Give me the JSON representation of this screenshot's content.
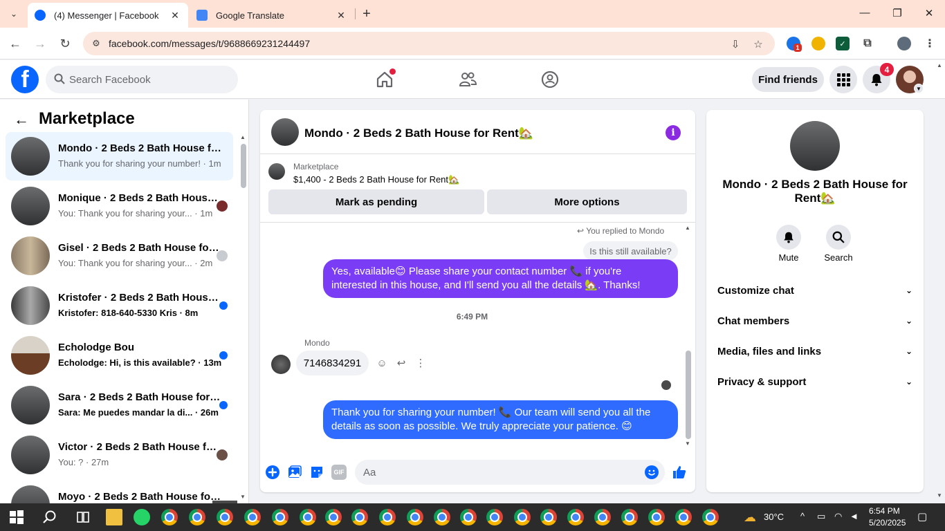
{
  "browser": {
    "tabs": [
      {
        "title": "(4) Messenger | Facebook",
        "active": true
      },
      {
        "title": "Google Translate",
        "active": false
      }
    ],
    "url": "facebook.com/messages/t/9688669231244497",
    "extension_badge": "1"
  },
  "fb": {
    "search_placeholder": "Search Facebook",
    "find_friends": "Find friends",
    "notifications_count": "4"
  },
  "left": {
    "title": "Marketplace",
    "conversations": [
      {
        "name": "Mondo · 2 Beds 2 Bath House for Rent",
        "preview": "Thank you for sharing your number! · 1m",
        "selected": true,
        "unread": false
      },
      {
        "name": "Monique · 2 Beds 2 Bath House for Rent",
        "preview": "You: Thank you for sharing your... · 1m",
        "selected": false,
        "unread": false
      },
      {
        "name": "Gisel · 2 Beds 2 Bath House for Rent",
        "preview": "You: Thank you for sharing your... · 2m",
        "selected": false,
        "unread": false
      },
      {
        "name": "Kristofer · 2 Beds 2 Bath House for Rent",
        "preview": "Kristofer: 818-640-5330 Kris · 8m",
        "selected": false,
        "unread": true
      },
      {
        "name": "Echolodge Bou",
        "preview": "Echolodge: Hi, is this available? · 13m",
        "selected": false,
        "unread": true
      },
      {
        "name": "Sara · 2 Beds 2 Bath House for Rent",
        "preview": "Sara: Me puedes mandar la di... · 26m",
        "selected": false,
        "unread": true
      },
      {
        "name": "Victor · 2 Beds 2 Bath House for Rent",
        "preview": "You: ? · 27m",
        "selected": false,
        "unread": false
      },
      {
        "name": "Moyo · 2 Beds 2 Bath House for Rent",
        "preview": "",
        "selected": false,
        "unread": false
      }
    ]
  },
  "chat": {
    "title": "Mondo · 2 Beds 2 Bath House for Rent🏡",
    "listing_label": "Marketplace",
    "listing_price": "$1,400 - 2 Beds 2 Bath House for Rent🏡",
    "mark_pending": "Mark as pending",
    "more_options": "More options",
    "replied_label": "You replied to Mondo",
    "quoted": "Is this still available?",
    "msg1": "Yes, available😊 Please share your contact number 📞 if you're interested in this house, and I'll send you all the details 🏡. Thanks!",
    "timestamp": "6:49 PM",
    "sender": "Mondo",
    "msg_in": "7146834291",
    "msg2": "Thank you for sharing your number! 📞 Our team will send you all the details as soon as possible. We truly appreciate your patience. 😊",
    "composer_placeholder": "Aa",
    "gif_label": "GIF"
  },
  "info": {
    "name": "Mondo · 2 Beds 2 Bath House for Rent🏡",
    "mute": "Mute",
    "search": "Search",
    "sections": [
      "Customize chat",
      "Chat members",
      "Media, files and links",
      "Privacy & support"
    ]
  },
  "taskbar": {
    "temperature": "30°C",
    "time": "6:54 PM",
    "date": "5/20/2025"
  },
  "colors": {
    "fb_blue": "#0866ff",
    "purple_bubble": "#7b3cf6",
    "blue_bubble": "#2f6bff",
    "tab_bar": "#fde2d5"
  }
}
